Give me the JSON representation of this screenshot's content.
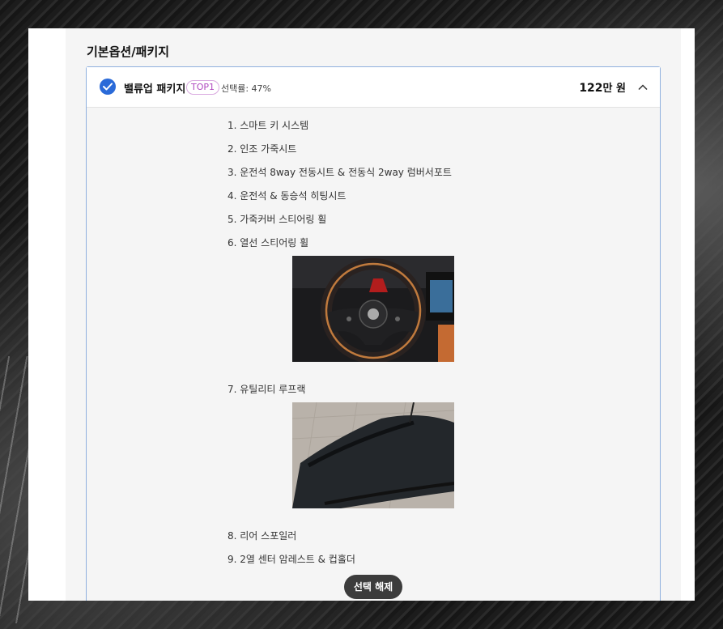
{
  "section": {
    "title": "기본옵션/패키지"
  },
  "package": {
    "name": "밸류업 패키지",
    "badge": "TOP1",
    "rate": "선택률: 47%",
    "price": "122",
    "price_unit": "만 원",
    "items": [
      "1. 스마트 키 시스템",
      "2. 인조 가죽시트",
      "3. 운전석 8way 전동시트 & 전동식 2way 럼버서포트",
      "4. 운전석 & 동승석 히팅시트",
      "5. 가죽커버 스티어링 휠",
      "6. 열선 스티어링 휠",
      "7. 유틸리티 루프랙",
      "8. 리어 스포일러",
      "9. 2열 센터 암레스트 & 컵홀더"
    ],
    "deselect_label": "선택 해제"
  },
  "colors": {
    "accent": "#2a6ad8",
    "badge": "#b04ac0",
    "card_border": "#8fb0de"
  }
}
